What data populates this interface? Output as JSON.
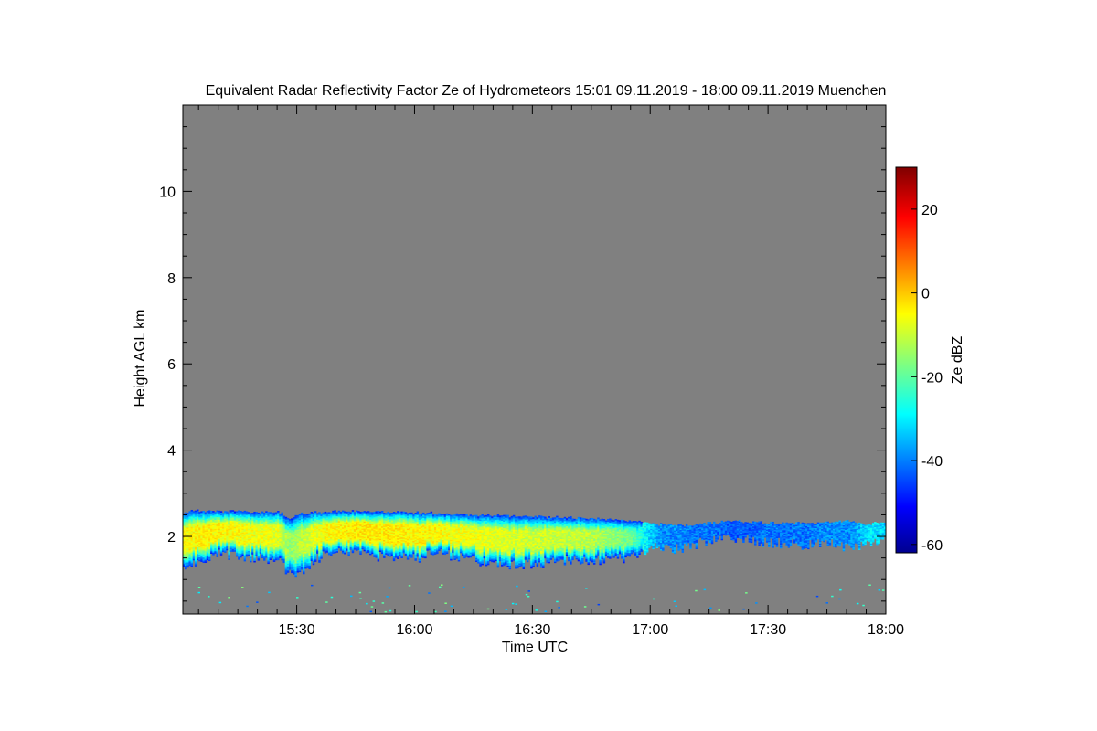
{
  "chart_data": {
    "type": "heatmap",
    "title": "Equivalent Radar Reflectivity Factor Ze of Hydrometeors   15:01 09.11.2019 - 18:00 09.11.2019 Muenchen",
    "xlabel": "Time UTC",
    "ylabel": "Height AGL km",
    "colorbar_label": "Ze dBZ",
    "x_range_minutes_utc": [
      901,
      1080
    ],
    "x_ticks": [
      {
        "minutes": 930,
        "label": "15:30"
      },
      {
        "minutes": 960,
        "label": "16:00"
      },
      {
        "minutes": 990,
        "label": "16:30"
      },
      {
        "minutes": 1020,
        "label": "17:00"
      },
      {
        "minutes": 1050,
        "label": "17:30"
      },
      {
        "minutes": 1080,
        "label": "18:00"
      }
    ],
    "ylim": [
      0.2,
      12
    ],
    "y_ticks": [
      2,
      4,
      6,
      8,
      10
    ],
    "color_range": [
      -62,
      30
    ],
    "color_ticks": [
      -60,
      -40,
      -20,
      0,
      20
    ],
    "colormap": "jet",
    "background_color": "#808080",
    "cloud_layer": {
      "time": [
        901,
        905,
        910,
        915,
        920,
        925,
        928,
        930,
        935,
        940,
        945,
        950,
        955,
        960,
        965,
        970,
        975,
        980,
        985,
        990,
        995,
        1000,
        1005,
        1010,
        1015,
        1020,
        1023,
        1027,
        1030,
        1035,
        1040,
        1045,
        1050,
        1055,
        1060,
        1065,
        1070,
        1073,
        1075,
        1077,
        1080
      ],
      "top_km": [
        2.55,
        2.58,
        2.57,
        2.56,
        2.55,
        2.56,
        2.4,
        2.5,
        2.55,
        2.58,
        2.57,
        2.56,
        2.55,
        2.54,
        2.53,
        2.5,
        2.48,
        2.47,
        2.45,
        2.45,
        2.43,
        2.42,
        2.4,
        2.38,
        2.35,
        2.3,
        2.25,
        2.25,
        2.25,
        2.3,
        2.35,
        2.33,
        2.3,
        2.3,
        2.3,
        2.3,
        2.35,
        2.3,
        2.25,
        2.3,
        2.3
      ],
      "base_km": [
        1.2,
        1.4,
        1.6,
        1.55,
        1.5,
        1.45,
        1.15,
        1.1,
        1.5,
        1.7,
        1.6,
        1.55,
        1.5,
        1.5,
        1.6,
        1.55,
        1.45,
        1.4,
        1.35,
        1.35,
        1.4,
        1.45,
        1.45,
        1.5,
        1.5,
        1.75,
        1.75,
        1.7,
        1.8,
        1.9,
        1.95,
        1.9,
        1.85,
        1.85,
        1.8,
        1.85,
        1.75,
        1.8,
        1.85,
        1.9,
        1.9
      ],
      "core_dbz": [
        -5,
        -4,
        -4,
        -5,
        -6,
        -7,
        -14,
        -12,
        -6,
        -4,
        -3,
        -3,
        -3,
        -4,
        -4,
        -6,
        -6,
        -7,
        -8,
        -9,
        -9,
        -10,
        -11,
        -14,
        -18,
        -32,
        -38,
        -38,
        -40,
        -40,
        -42,
        -42,
        -40,
        -40,
        -40,
        -38,
        -38,
        -34,
        -30,
        -30,
        -32
      ]
    }
  }
}
